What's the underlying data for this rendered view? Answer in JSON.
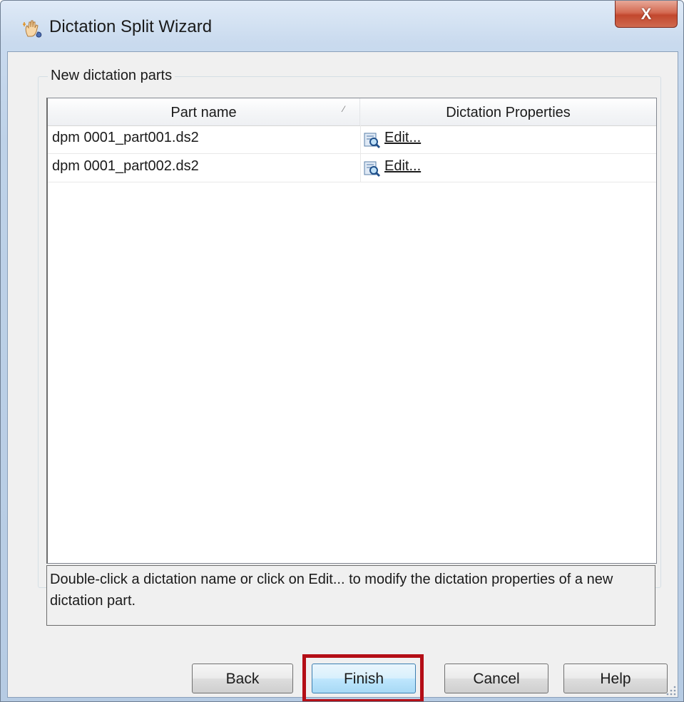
{
  "window": {
    "title": "Dictation Split Wizard",
    "close_label": "X"
  },
  "group": {
    "label": "New dictation parts"
  },
  "table": {
    "columns": [
      "Part name",
      "Dictation Properties"
    ],
    "rows": [
      {
        "part_name": "dpm 0001_part001.ds2",
        "action": "Edit..."
      },
      {
        "part_name": "dpm 0001_part002.ds2",
        "action": "Edit..."
      }
    ]
  },
  "hint": {
    "text": "Double-click a dictation name or click on Edit... to modify the dictation properties of a new dictation part."
  },
  "buttons": {
    "back": "Back",
    "finish": "Finish",
    "cancel": "Cancel",
    "help": "Help"
  },
  "colors": {
    "highlight": "#b40e16",
    "close_button": "#c2472e"
  }
}
